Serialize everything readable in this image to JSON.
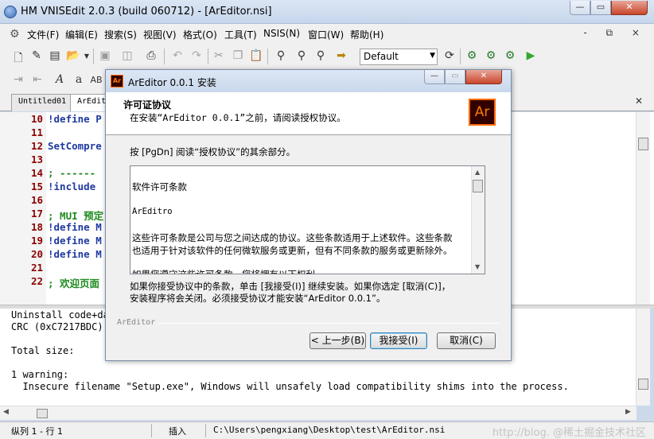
{
  "window": {
    "title": "HM VNISEdit 2.0.3 (build 060712) - [ArEditor.nsi]",
    "min_glyph": "—",
    "max_glyph": "▭",
    "close_glyph": "✕",
    "mdi_controls": "- ⧉ ×"
  },
  "menu": {
    "items": [
      "文件(F)",
      "编辑(E)",
      "搜索(S)",
      "视图(V)",
      "格式(O)",
      "工具(T)",
      "NSIS(N)",
      "窗口(W)",
      "帮助(H)"
    ]
  },
  "toolbar": {
    "style_value": "Default",
    "icons1": [
      "new-file-icon",
      "wizard-icon",
      "template-icon",
      "open-icon",
      "dropdown-icon",
      "save-icon",
      "save-all-icon",
      "print-icon",
      "undo-icon",
      "redo-icon",
      "cut-icon",
      "copy-icon",
      "paste-icon",
      "find-icon",
      "find-next-icon",
      "replace-icon",
      "goto-icon"
    ],
    "icons2": [
      "indent-icon",
      "outdent-icon",
      "font-bold-icon",
      "font-normal-icon",
      "font-style-icon"
    ]
  },
  "tabs": [
    "Untitled01",
    "ArEdit"
  ],
  "editor": {
    "lines": [
      {
        "no": "10",
        "code": "!define P",
        "type": "directive"
      },
      {
        "no": "11",
        "code": "",
        "type": "directive"
      },
      {
        "no": "12",
        "code": "SetCompre",
        "type": "directive"
      },
      {
        "no": "13",
        "code": "",
        "type": "directive"
      },
      {
        "no": "14",
        "code": "; ------",
        "type": "comment"
      },
      {
        "no": "15",
        "code": "!include",
        "type": "directive"
      },
      {
        "no": "16",
        "code": "",
        "type": "directive"
      },
      {
        "no": "17",
        "code": "; MUI 预定",
        "type": "comment"
      },
      {
        "no": "18",
        "code": "!define M",
        "type": "directive"
      },
      {
        "no": "19",
        "code": "!define M",
        "type": "directive"
      },
      {
        "no": "20",
        "code": "!define M",
        "type": "directive"
      },
      {
        "no": "21",
        "code": "",
        "type": "directive"
      },
      {
        "no": "22",
        "code": "; 欢迎页面",
        "type": "comment"
      }
    ]
  },
  "output": {
    "lines": [
      "Uninstall code+da",
      "CRC (0xC7217BDC):",
      "",
      "Total size:",
      "",
      "1 warning:",
      "  Insecure filename \"Setup.exe\", Windows will unsafely load compatibility shims into the process."
    ]
  },
  "status": {
    "position": "纵列 1 - 行 1",
    "mode": "插入",
    "path": "C:\\Users\\pengxiang\\Desktop\\test\\ArEditor.nsi",
    "watermark": "http://blog. @稀土掘金技术社区"
  },
  "dialog": {
    "title": "ArEditor 0.0.1 安装",
    "icon_text": "Ar",
    "logo_text": "Ar",
    "heading": "许可证协议",
    "subheading": "在安装“ArEditor 0.0.1”之前，请阅读授权协议。",
    "instruction": "按 [PgDn] 阅读“授权协议”的其余部分。",
    "license_lines": [
      "软件许可条款",
      "ArEditro",
      "这些许可条款是公司与您之间达成的协议。这些条款适用于上述软件。这些条款",
      "也适用于针对该软件的任何微软服务或更新，但有不同条款的服务或更新除外。",
      "如果您遵守这些许可条款，您将拥有以下权利。"
    ],
    "note_line1": "如果你接受协议中的条款，单击 [我接受(I)] 继续安装。如果你选定 [取消(C)]，",
    "note_line2": "安装程序将会关闭。必须接受协议才能安装“ArEditor 0.0.1”。",
    "brand": "ArEditor",
    "back_label": "< 上一步(B)",
    "accept_label": "我接受(I)",
    "cancel_label": "取消(C)"
  }
}
